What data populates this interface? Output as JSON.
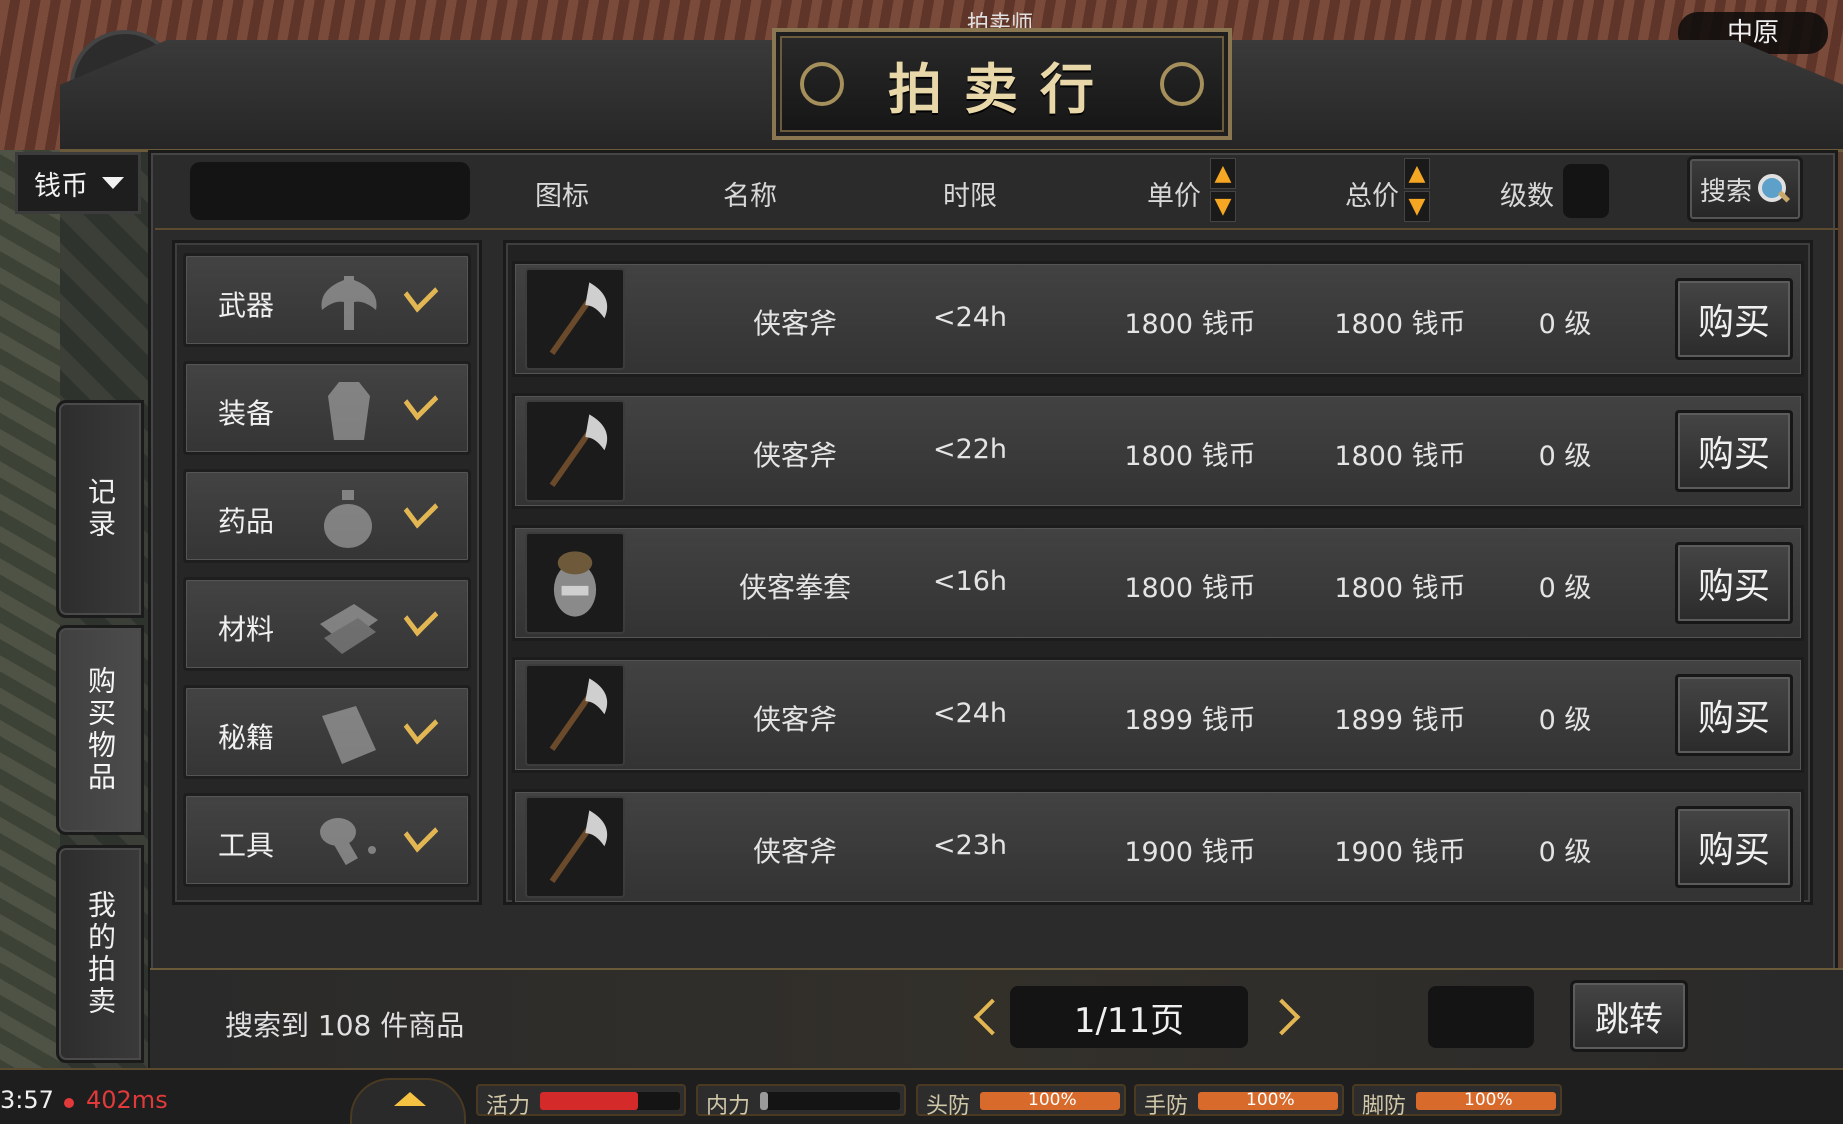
{
  "region": "中原",
  "title_above": "拍卖师",
  "title": "拍卖行",
  "currency": {
    "label": "钱币"
  },
  "search": {
    "value": "",
    "button_label": "搜索"
  },
  "columns": {
    "icon": "图标",
    "name": "名称",
    "time": "时限",
    "unit_price": "单价",
    "total_price": "总价",
    "level": "级数"
  },
  "side_tabs": [
    {
      "label": "记录",
      "active": false
    },
    {
      "label": "购买物品",
      "active": true
    },
    {
      "label": "我的拍卖",
      "active": false
    }
  ],
  "categories": [
    {
      "label": "武器",
      "icon": "axe-icon"
    },
    {
      "label": "装备",
      "icon": "robe-icon"
    },
    {
      "label": "药品",
      "icon": "potion-icon"
    },
    {
      "label": "材料",
      "icon": "cloth-icon"
    },
    {
      "label": "秘籍",
      "icon": "book-icon"
    },
    {
      "label": "工具",
      "icon": "tool-icon"
    }
  ],
  "items": [
    {
      "icon": "axe-item-icon",
      "name": "侠客斧",
      "time": "<24h",
      "unit": "1800 钱币",
      "total": "1800 钱币",
      "level": "0 级",
      "buy": "购买"
    },
    {
      "icon": "axe-item-icon",
      "name": "侠客斧",
      "time": "<22h",
      "unit": "1800 钱币",
      "total": "1800 钱币",
      "level": "0 级",
      "buy": "购买"
    },
    {
      "icon": "gauntlet-item-icon",
      "name": "侠客拳套",
      "time": "<16h",
      "unit": "1800 钱币",
      "total": "1800 钱币",
      "level": "0 级",
      "buy": "购买"
    },
    {
      "icon": "axe-item-icon",
      "name": "侠客斧",
      "time": "<24h",
      "unit": "1899 钱币",
      "total": "1899 钱币",
      "level": "0 级",
      "buy": "购买"
    },
    {
      "icon": "axe-item-icon",
      "name": "侠客斧",
      "time": "<23h",
      "unit": "1900 钱币",
      "total": "1900 钱币",
      "level": "0 级",
      "buy": "购买"
    }
  ],
  "footer": {
    "result_text": "搜索到 108 件商品",
    "page": "1/11页",
    "jump_value": "",
    "jump_label": "跳转"
  },
  "hud": {
    "clock": "3:57",
    "ping": "402ms",
    "stats": [
      {
        "label": "活力",
        "value": "",
        "fill": 0.7,
        "color": "#d42a2a"
      },
      {
        "label": "内力",
        "value": "",
        "fill": 0.06,
        "color": "#9a9a9a"
      },
      {
        "label": "头防",
        "value": "100%",
        "fill": 1.0,
        "color": "#d86a2c"
      },
      {
        "label": "手防",
        "value": "100%",
        "fill": 1.0,
        "color": "#d86a2c"
      },
      {
        "label": "脚防",
        "value": "100%",
        "fill": 1.0,
        "color": "#d86a2c"
      }
    ]
  },
  "colors": {
    "accent_gold": "#e2b652",
    "sort_arrow": "#f5a623",
    "ping_red": "#e23a3a"
  }
}
